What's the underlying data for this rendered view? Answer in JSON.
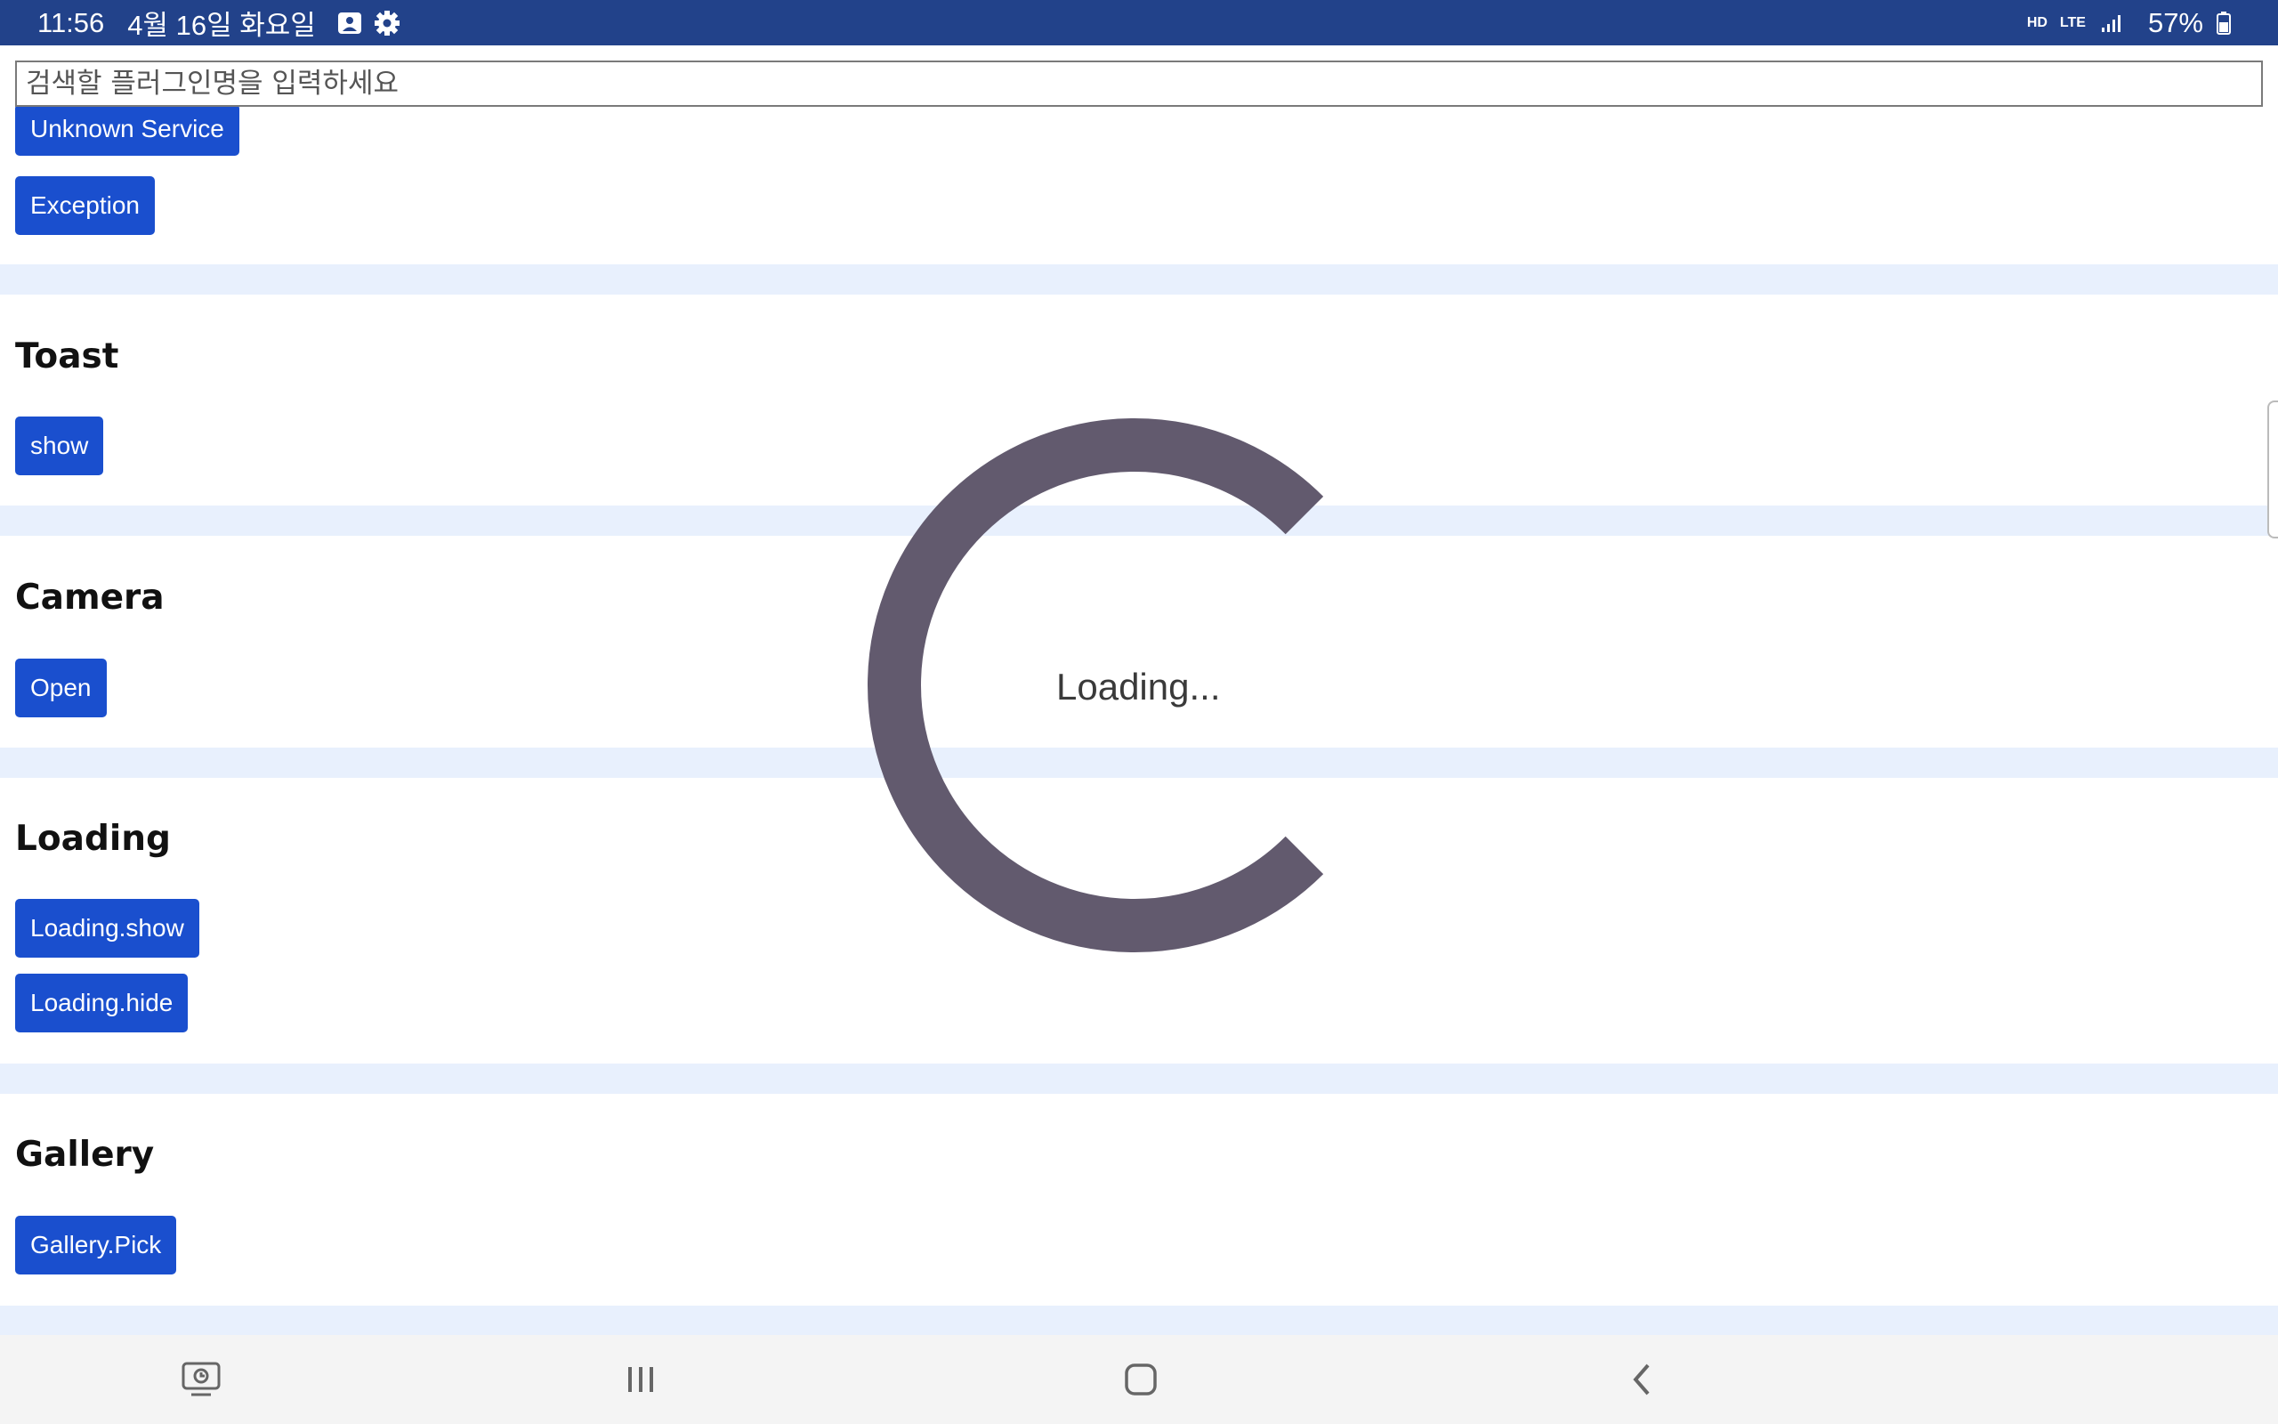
{
  "status_bar": {
    "time": "11:56",
    "date": "4월 16일 화요일",
    "hd_voice": "HD",
    "network": "LTE",
    "battery": "57%",
    "icons": [
      "image-icon",
      "gear-icon",
      "signal-icon",
      "battery-icon"
    ]
  },
  "search": {
    "placeholder": "검색할 플러그인명을 입력하세요"
  },
  "sections": {
    "top_buttons": [
      "Unknown Service",
      "Exception"
    ],
    "toast": {
      "title": "Toast",
      "buttons": [
        "show"
      ]
    },
    "camera": {
      "title": "Camera",
      "buttons": [
        "Open"
      ]
    },
    "loading": {
      "title": "Loading",
      "buttons": [
        "Loading.show",
        "Loading.hide"
      ]
    },
    "gallery": {
      "title": "Gallery",
      "buttons": [
        "Gallery.Pick"
      ]
    }
  },
  "overlay": {
    "text": "Loading...",
    "color": "#625a6e"
  },
  "navbar": {
    "icons": [
      "recent-apps-icon",
      "menu-icon",
      "home-icon",
      "back-icon"
    ]
  },
  "colors": {
    "status_bar": "#22428a",
    "button": "#1a4fce",
    "separator": "#e8f0fd"
  }
}
